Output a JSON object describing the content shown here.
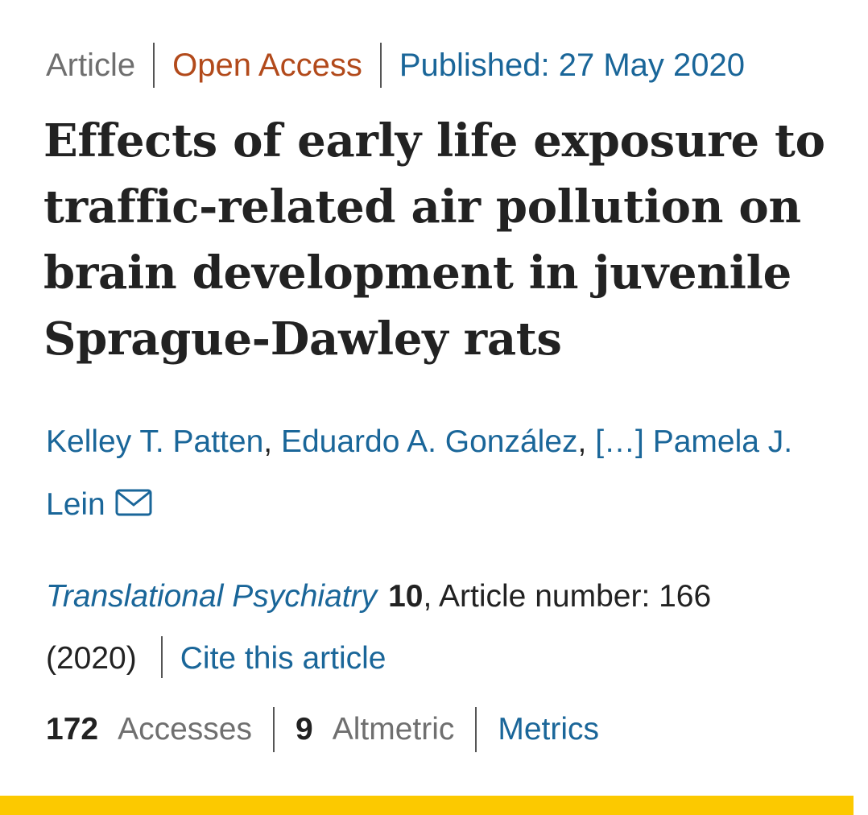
{
  "meta": {
    "type": "Article",
    "access": "Open Access",
    "published": "Published: 27 May 2020"
  },
  "title": "Effects of early life exposure to traffic-related air pollution on brain development in juvenile Sprague-Dawley rats",
  "authors": {
    "first": "Kelley T. Patten",
    "second": "Eduardo A. González",
    "separator": ", ",
    "ellipsis": "[…]",
    "last": "Pamela J. Lein",
    "contact_icon": "envelope-icon"
  },
  "citation": {
    "journal": "Translational Psychiatry",
    "volume": "10",
    "article_number": ", Article number: 166",
    "year": "(2020)",
    "cite_link": "Cite this article"
  },
  "metrics": {
    "accesses_count": "172",
    "accesses_label": "Accesses",
    "altmetric_count": "9",
    "altmetric_label": "Altmetric",
    "metrics_link": "Metrics"
  },
  "colors": {
    "link": "#1a6699",
    "open_access": "#b24a1b",
    "muted": "#6f6f6f",
    "text": "#222222",
    "accent_bar": "#fcc900"
  }
}
